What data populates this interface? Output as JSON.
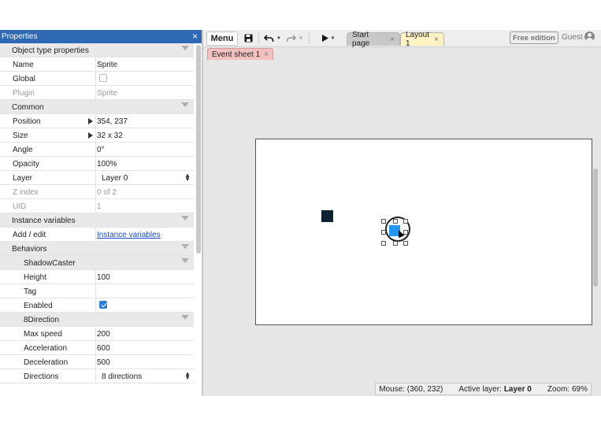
{
  "properties_panel": {
    "title": "Properties",
    "close": "×",
    "rows": [
      {
        "type": "section",
        "label": "Object type properties"
      },
      {
        "type": "prop",
        "label": "Name",
        "value": "Sprite"
      },
      {
        "type": "check",
        "label": "Global",
        "checked": false
      },
      {
        "type": "prop",
        "label": "Plugin",
        "value": "Sprite",
        "disabled": true
      },
      {
        "type": "section",
        "label": "Common"
      },
      {
        "type": "prop",
        "label": "Position",
        "value": "354, 237",
        "expand": true
      },
      {
        "type": "prop",
        "label": "Size",
        "value": "32 x 32",
        "expand": true
      },
      {
        "type": "prop",
        "label": "Angle",
        "value": "0°"
      },
      {
        "type": "prop",
        "label": "Opacity",
        "value": "100%"
      },
      {
        "type": "select",
        "label": "Layer",
        "value": "Layer 0"
      },
      {
        "type": "prop",
        "label": "Z index",
        "value": "0 of 2",
        "disabled": true
      },
      {
        "type": "prop",
        "label": "UID",
        "value": "1",
        "disabled": true
      },
      {
        "type": "section",
        "label": "Instance variables"
      },
      {
        "type": "link",
        "label": "Add / edit",
        "value": "Instance variables"
      },
      {
        "type": "section",
        "label": "Behaviors"
      },
      {
        "type": "section",
        "label": "ShadowCaster",
        "sub": true
      },
      {
        "type": "prop",
        "label": "Height",
        "value": "100",
        "sub": true
      },
      {
        "type": "prop",
        "label": "Tag",
        "value": "",
        "sub": true
      },
      {
        "type": "check",
        "label": "Enabled",
        "checked": true,
        "sub": true
      },
      {
        "type": "section",
        "label": "8Direction",
        "sub": true
      },
      {
        "type": "prop",
        "label": "Max speed",
        "value": "200",
        "sub": true
      },
      {
        "type": "prop",
        "label": "Acceleration",
        "value": "600",
        "sub": true
      },
      {
        "type": "prop",
        "label": "Deceleration",
        "value": "500",
        "sub": true
      },
      {
        "type": "select",
        "label": "Directions",
        "value": "8 directions",
        "sub": true
      }
    ]
  },
  "toolbar": {
    "menu_label": "Menu",
    "tabs": [
      {
        "label": "Start page",
        "close": "×"
      },
      {
        "label": "Layout 1",
        "close": "×"
      }
    ],
    "free_edition": "Free edition",
    "user": "Guest"
  },
  "event_tab": {
    "label": "Event sheet 1",
    "close": "×"
  },
  "status_bar": {
    "mouse": "Mouse: (360, 232)",
    "active_layer_label": "Active layer:",
    "active_layer_value": "Layer 0",
    "zoom": "Zoom: 69%"
  },
  "icons": {
    "save": "floppy-disk-icon",
    "undo": "undo-icon",
    "redo": "redo-icon",
    "run": "play-icon",
    "user": "user-icon"
  },
  "colors": {
    "panel_header": "#2f68b3",
    "selected_sprite": "#2196f3",
    "dark_sprite": "#0d2230",
    "layout_tab": "#fff3c4",
    "event_tab": "#f3c0c0",
    "checkbox_checked": "#2b7de0"
  }
}
